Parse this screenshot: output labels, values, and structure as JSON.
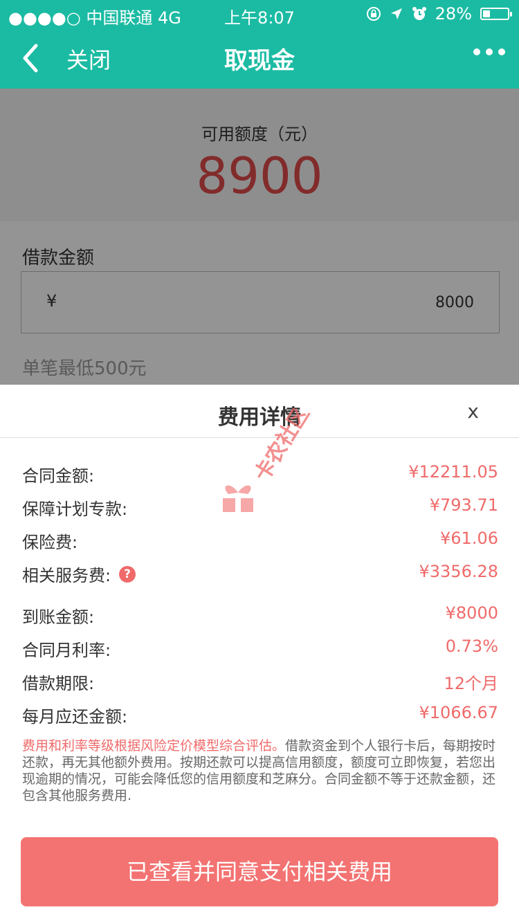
{
  "status_bar": {
    "carrier": "●●●●○ 中国联通  4G",
    "time": "上午8:07",
    "battery": "28%",
    "battery_level": 0.28
  },
  "nav": {
    "close_label": "关闭",
    "title": "取现金"
  },
  "credit": {
    "label": "可用额度（元）",
    "value": "8900"
  },
  "loan": {
    "label": "借款金额",
    "currency": "¥",
    "amount": "8000",
    "min_note": "单笔最低500元"
  },
  "fee_sheet": {
    "title": "费用详情",
    "close": "x",
    "rows": [
      {
        "label": "合同金额:",
        "value": "¥12211.05"
      },
      {
        "label": "保障计划专款:",
        "value": "¥793.71"
      },
      {
        "label": "保险费:",
        "value": "¥61.06"
      },
      {
        "label": "相关服务费:",
        "value": "¥3356.28"
      },
      {
        "label": "到账金额:",
        "value": "¥8000"
      },
      {
        "label": "合同月利率:",
        "value": "0.73%"
      },
      {
        "label": "借款期限:",
        "value": "12个月"
      },
      {
        "label": "每月应还金额:",
        "value": "¥1066.67"
      }
    ],
    "help_glyph": "?",
    "disclaimer_highlight": "费用和利率等级根据风险定价模型综合评估。",
    "disclaimer_rest": "借款资金到个人银行卡后，每期按时还款，再无其他额外费用。按期还款可以提高信用额度，额度可立即恢复，若您出现逾期的情况，可能会降低您的信用额度和芝麻分。合同金额不等于还款金额，还包含其他服务费用.",
    "agree_button": "已查看并同意支付相关费用"
  },
  "watermark": {
    "text": "卡农社区"
  },
  "colors": {
    "brand": "#1bbba3",
    "accent": "#f06a6a",
    "button": "#f37372",
    "credit_value": "#e04a4a"
  },
  "icons": [
    "back-chevron-icon",
    "more-dots-icon",
    "lock-rotation-icon",
    "location-arrow-icon",
    "alarm-icon",
    "battery-icon",
    "help-icon"
  ]
}
